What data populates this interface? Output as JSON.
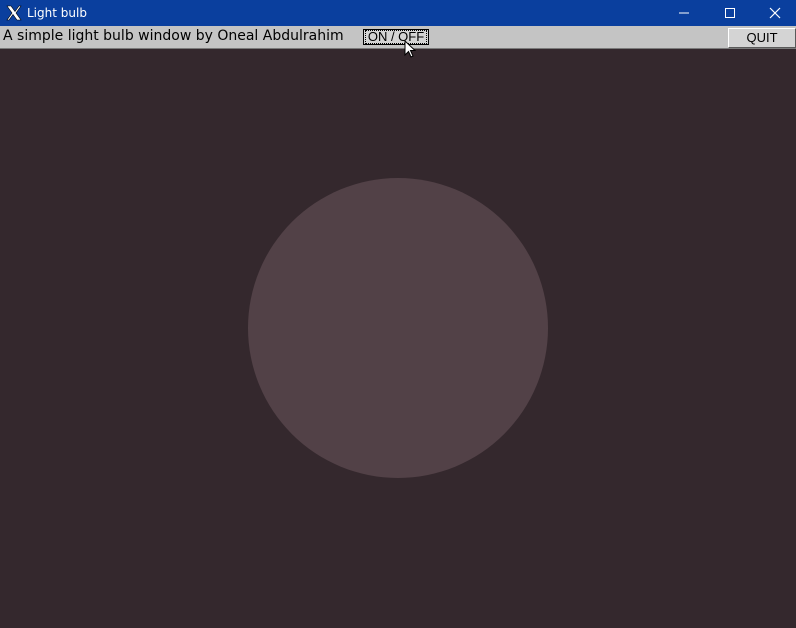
{
  "window": {
    "title": "Light bulb",
    "title_icon": "x-logo-icon",
    "controls": {
      "minimize": "minimize-icon",
      "maximize": "maximize-icon",
      "close": "close-icon"
    }
  },
  "toolbar": {
    "description": "A simple light bulb window by Oneal Abdulrahim",
    "toggle_label": "ON / OFF",
    "quit_label": "QUIT"
  },
  "bulb": {
    "state": "off",
    "color": "#524147"
  },
  "colors": {
    "titlebar": "#0a3f9e",
    "toolbar": "#c4c4c4",
    "background": "#34282d"
  }
}
